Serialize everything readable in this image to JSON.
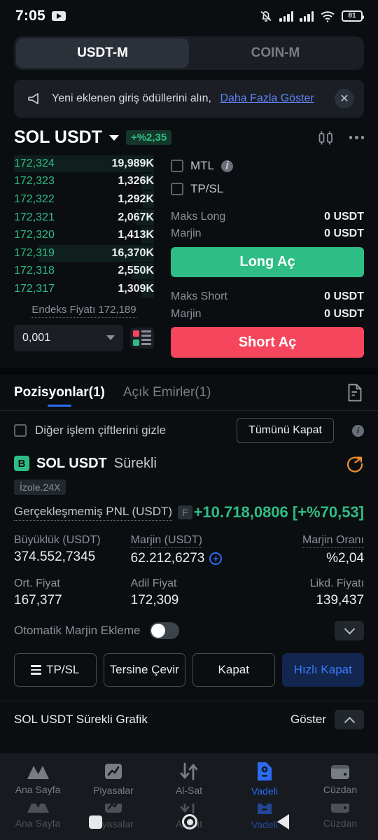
{
  "status_bar": {
    "time": "7:05",
    "battery": "81",
    "icons": [
      "youtube-icon",
      "bell-muted-icon",
      "signal-icon",
      "signal-icon",
      "wifi-icon",
      "battery-icon"
    ]
  },
  "segmented": {
    "usdtm": "USDT-M",
    "coinm": "COIN-M",
    "active": "USDT-M"
  },
  "banner": {
    "text": "Yeni eklenen giriş ödüllerini alın,",
    "link": "Daha Fazla Göster",
    "close": "✕"
  },
  "pair_header": {
    "name": "SOL USDT",
    "change": "+%2,35"
  },
  "orderbook": {
    "rows": [
      {
        "price": "172,324",
        "qty": "19,989K",
        "depth": 100
      },
      {
        "price": "172,323",
        "qty": "1,326K",
        "depth": 9
      },
      {
        "price": "172,322",
        "qty": "1,292K",
        "depth": 8
      },
      {
        "price": "172,321",
        "qty": "2,067K",
        "depth": 13
      },
      {
        "price": "172,320",
        "qty": "1,413K",
        "depth": 9
      },
      {
        "price": "172,319",
        "qty": "16,370K",
        "depth": 82
      },
      {
        "price": "172,318",
        "qty": "2,550K",
        "depth": 16
      },
      {
        "price": "172,317",
        "qty": "1,309K",
        "depth": 9
      }
    ],
    "index_price": "Endeks Fiyatı 172,189",
    "tick_size": "0,001"
  },
  "order_panel": {
    "mtl_label": "MTL",
    "tpsl_label": "TP/SL",
    "max_long_label": "Maks Long",
    "max_long_value": "0 USDT",
    "margin_long_label": "Marjin",
    "margin_long_value": "0 USDT",
    "long_button": "Long Aç",
    "max_short_label": "Maks Short",
    "max_short_value": "0 USDT",
    "margin_short_label": "Marjin",
    "margin_short_value": "0 USDT",
    "short_button": "Short Aç"
  },
  "tabs": {
    "positions": "Pozisyonlar(1)",
    "open_orders": "Açık Emirler(1)",
    "active": "Pozisyonlar(1)"
  },
  "filter_row": {
    "hide_label": "Diğer işlem çiftlerini gizle",
    "close_all": "Tümünü Kapat"
  },
  "position": {
    "side_badge": "B",
    "pair": "SOL USDT",
    "kind": "Sürekli",
    "leverage": "İzole.24X",
    "pnl_label": "Gerçekleşmemiş PNL (USDT)",
    "pnl_flag": "F",
    "pnl_value": "+10.718,0806 [+%70,53]",
    "stats": [
      {
        "label": "Büyüklük (USDT)",
        "value": "374.552,7345",
        "align": "l",
        "dotted": false,
        "plus": false
      },
      {
        "label": "Marjin (USDT)",
        "value": "62.212,6273",
        "align": "l",
        "dotted": true,
        "plus": true
      },
      {
        "label": "Marjin Oranı",
        "value": "%2,04",
        "align": "r",
        "dotted": true,
        "plus": false
      },
      {
        "label": "Ort. Fiyat",
        "value": "167,377",
        "align": "l",
        "dotted": false,
        "plus": false
      },
      {
        "label": "Adil Fiyat",
        "value": "172,309",
        "align": "l",
        "dotted": false,
        "plus": false
      },
      {
        "label": "Likd. Fiyatı",
        "value": "139,437",
        "align": "r",
        "dotted": false,
        "plus": false
      }
    ],
    "auto_margin_label": "Otomatik Marjin Ekleme",
    "auto_margin_on": false,
    "buttons": [
      "TP/SL",
      "Tersine Çevir",
      "Kapat",
      "Hızlı Kapat"
    ]
  },
  "chart_bar": {
    "title": "SOL USDT Sürekli Grafik",
    "toggle": "Göster"
  },
  "bottom_nav": {
    "items": [
      {
        "label": "Ana Sayfa",
        "icon": "home-icon"
      },
      {
        "label": "Piyasalar",
        "icon": "markets-icon"
      },
      {
        "label": "Al-Sat",
        "icon": "trade-icon"
      },
      {
        "label": "Vadeli",
        "icon": "futures-icon"
      },
      {
        "label": "Cüzdan",
        "icon": "wallet-icon"
      }
    ],
    "active_index": 3
  },
  "android_nav": {
    "recents": "square",
    "home": "circle",
    "back": "triangle"
  },
  "colors": {
    "green": "#2ebd85",
    "red": "#f6465d",
    "blue": "#2b6cf6",
    "bg": "#0b0e11",
    "panel": "#1b1f25"
  }
}
